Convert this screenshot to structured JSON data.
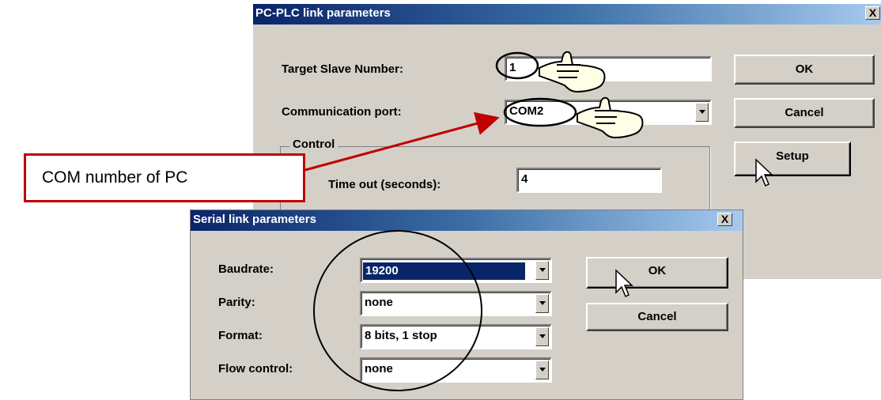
{
  "pc_plc": {
    "title": "PC-PLC link parameters",
    "close_label": "X",
    "target_slave_label": "Target Slave Number:",
    "target_slave_value": "1",
    "comm_port_label": "Communication port:",
    "comm_port_value": "COM2",
    "control_group_label": "Control",
    "timeout_label": "Time out (seconds):",
    "timeout_value": "4",
    "ok_label": "OK",
    "cancel_label": "Cancel",
    "setup_label": "Setup"
  },
  "serial": {
    "title": "Serial link parameters",
    "close_label": "X",
    "baudrate_label": "Baudrate:",
    "baudrate_value": "19200",
    "parity_label": "Parity:",
    "parity_value": "none",
    "format_label": "Format:",
    "format_value": "8 bits, 1 stop",
    "flow_label": "Flow control:",
    "flow_value": "none",
    "ok_label": "OK",
    "cancel_label": "Cancel"
  },
  "annotation": {
    "callout_text": "COM number of PC",
    "arrow_color": "#c00000"
  },
  "icons": [
    "pointing-hand-icon",
    "mouse-cursor-icon",
    "chevron-down-icon",
    "close-icon"
  ]
}
